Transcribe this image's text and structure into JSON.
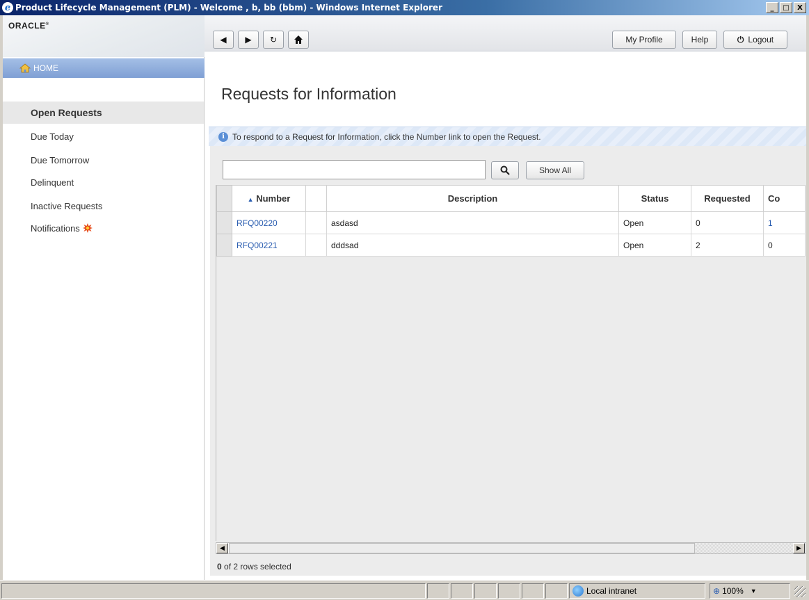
{
  "window": {
    "title": "Product Lifecycle Management (PLM) - Welcome , b, bb (bbm) - Windows Internet Explorer",
    "minimize": "_",
    "maximize": "□",
    "close": "X"
  },
  "brand": {
    "logo": "ORACLE"
  },
  "toolbar": {
    "my_profile": "My Profile",
    "help": "Help",
    "logout": "Logout"
  },
  "home_tab": {
    "label": "HOME"
  },
  "sidebar": {
    "items": [
      {
        "label": "Open Requests",
        "active": true
      },
      {
        "label": "Due Today"
      },
      {
        "label": "Due Tomorrow"
      },
      {
        "label": "Delinquent"
      },
      {
        "label": "Inactive Requests"
      },
      {
        "label": "Notifications"
      }
    ]
  },
  "main": {
    "title": "Requests for Information",
    "info": "To respond to a Request for Information, click the Number link to open the Request.",
    "search": {
      "value": "",
      "show_all": "Show All"
    },
    "table": {
      "columns": [
        "Number",
        "Description",
        "Status",
        "Requested",
        "Co"
      ],
      "sort_indicator": "▲",
      "rows": [
        {
          "number": "RFQ00220",
          "description": "asdasd",
          "status": "Open",
          "requested": "0",
          "co": "1"
        },
        {
          "number": "RFQ00221",
          "description": "dddsad",
          "status": "Open",
          "requested": "2",
          "co": "0"
        }
      ]
    },
    "selection": {
      "count": "0",
      "text": "of 2 rows selected"
    }
  },
  "statusbar": {
    "zone": "Local intranet",
    "zoom": "100%"
  }
}
